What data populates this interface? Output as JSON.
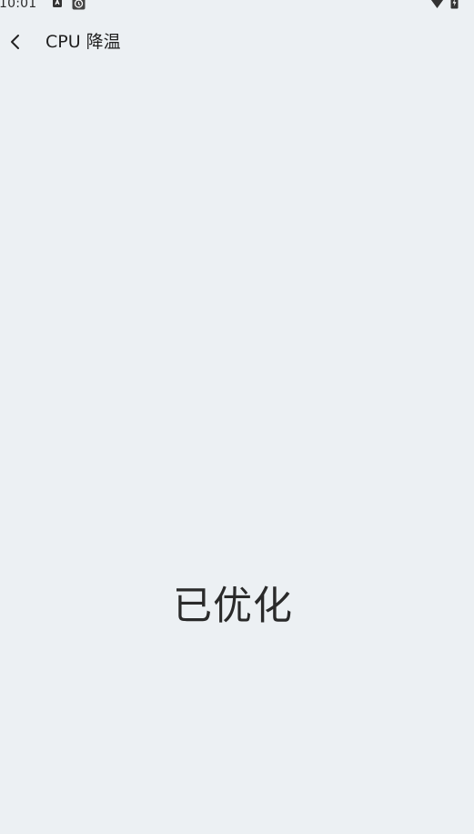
{
  "status_bar": {
    "time": "10:01",
    "left_icons": [
      "sim-card-icon",
      "settings-sync-icon"
    ],
    "right_icons": [
      "wifi-icon",
      "battery-charging-icon"
    ]
  },
  "header": {
    "back_icon": "chevron-left-icon",
    "title": "CPU 降温"
  },
  "main": {
    "status_text": "已优化"
  },
  "colors": {
    "background": "#ecf0f3",
    "text": "#1f1f1f"
  }
}
